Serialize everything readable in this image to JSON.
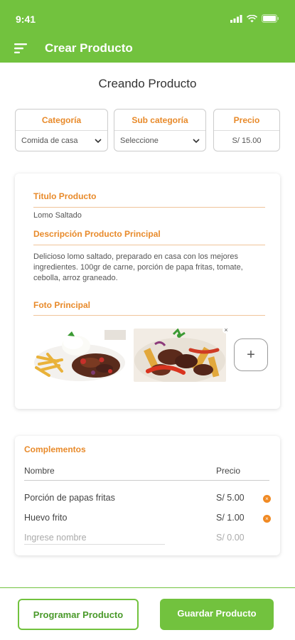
{
  "status_bar": {
    "time": "9:41"
  },
  "appbar": {
    "title": "Crear Producto"
  },
  "page": {
    "title": "Creando Producto"
  },
  "selectors": {
    "category": {
      "label": "Categoría",
      "value": "Comida de casa"
    },
    "subcategory": {
      "label": "Sub categoría",
      "value": "Seleccione"
    },
    "price": {
      "label": "Precio",
      "value": "S/ 15.00"
    }
  },
  "product": {
    "title_label": "Titulo Producto",
    "title_value": "Lomo Saltado",
    "desc_label": "Descripción Producto  Principal",
    "desc_value": "Delicioso lomo saltado, preparado en casa con los mejores ingredientes. 100gr de carne, porción de papa fritas, tomate, cebolla, arroz graneado.",
    "photo_label": "Foto Principal",
    "add_symbol": "+",
    "close_symbol": "×"
  },
  "complements": {
    "title": "Complementos",
    "col_name": "Nombre",
    "col_price": "Precio",
    "rows": [
      {
        "name": "Porción de papas fritas",
        "price": "S/ 5.00"
      },
      {
        "name": "Huevo frito",
        "price": "S/ 1.00"
      }
    ],
    "new_name_placeholder": "Ingrese nombre",
    "new_price_placeholder": "S/ 0.00",
    "delete_symbol": "×"
  },
  "buttons": {
    "schedule": "Programar Producto",
    "save": "Guardar Producto"
  },
  "colors": {
    "brand_green": "#72c23e",
    "accent_orange": "#e88a2a"
  }
}
